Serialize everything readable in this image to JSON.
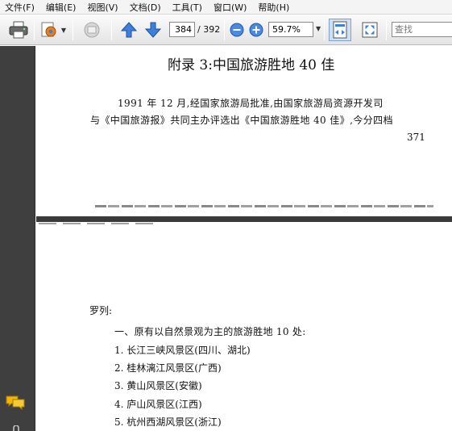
{
  "menu": [
    "文件(F)",
    "编辑(E)",
    "视图(V)",
    "文档(D)",
    "工具(T)",
    "窗口(W)",
    "帮助(H)"
  ],
  "toolbar": {
    "page_current": "384",
    "page_total": "/ 392",
    "zoom": "59.7%",
    "search_placeholder": "查找",
    "icons": [
      "print-icon",
      "settings-icon",
      "hand-tool-icon",
      "prev-page-icon",
      "next-page-icon",
      "zoom-out-icon",
      "zoom-in-icon",
      "fit-width-icon",
      "full-screen-icon"
    ]
  },
  "document": {
    "page1": {
      "title": "附录 3:中国旅游胜地 40 佳",
      "line1": "1991 年 12 月,经国家旅游局批准,由国家旅游局资源开发司",
      "line2": "与《中国旅游报》共同主办评选出《中国旅游胜地 40 佳》,今分四档",
      "page_number": "371"
    },
    "page2": {
      "label": "罗列:",
      "heading": "一、原有以自然景观为主的旅游胜地 10 处:",
      "items": [
        "1. 长江三峡风景区(四川、湖北)",
        "2. 桂林漓江风景区(广西)",
        "3. 黄山风景区(安徽)",
        "4. 庐山风景区(江西)",
        "5. 杭州西湖风景区(浙江)"
      ]
    }
  },
  "colors": {
    "panel": "#3f3f3f",
    "accent_blue": "#2f6fd6",
    "comment_icon": "#f2b705"
  }
}
